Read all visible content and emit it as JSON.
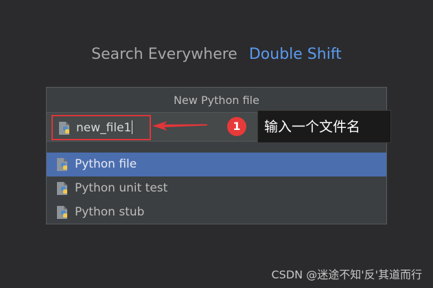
{
  "background_hint": {
    "label": "Search Everywhere",
    "shortcut": "Double Shift",
    "shortcut_color": "#5b9bf0"
  },
  "dialog": {
    "title": "New Python file",
    "name_input": {
      "value": "new_file1",
      "icon": "python-file-icon"
    },
    "kinds": [
      {
        "label": "Python file",
        "icon": "python-file-icon",
        "selected": true
      },
      {
        "label": "Python unit test",
        "icon": "python-file-icon",
        "selected": false
      },
      {
        "label": "Python stub",
        "icon": "python-file-icon",
        "selected": false
      }
    ],
    "selection_color": "#4b6eaf"
  },
  "annotation": {
    "step": "1",
    "text": "输入一个文件名",
    "color": "#e0363a"
  },
  "watermark": "CSDN @迷途不知'反'其道而行"
}
